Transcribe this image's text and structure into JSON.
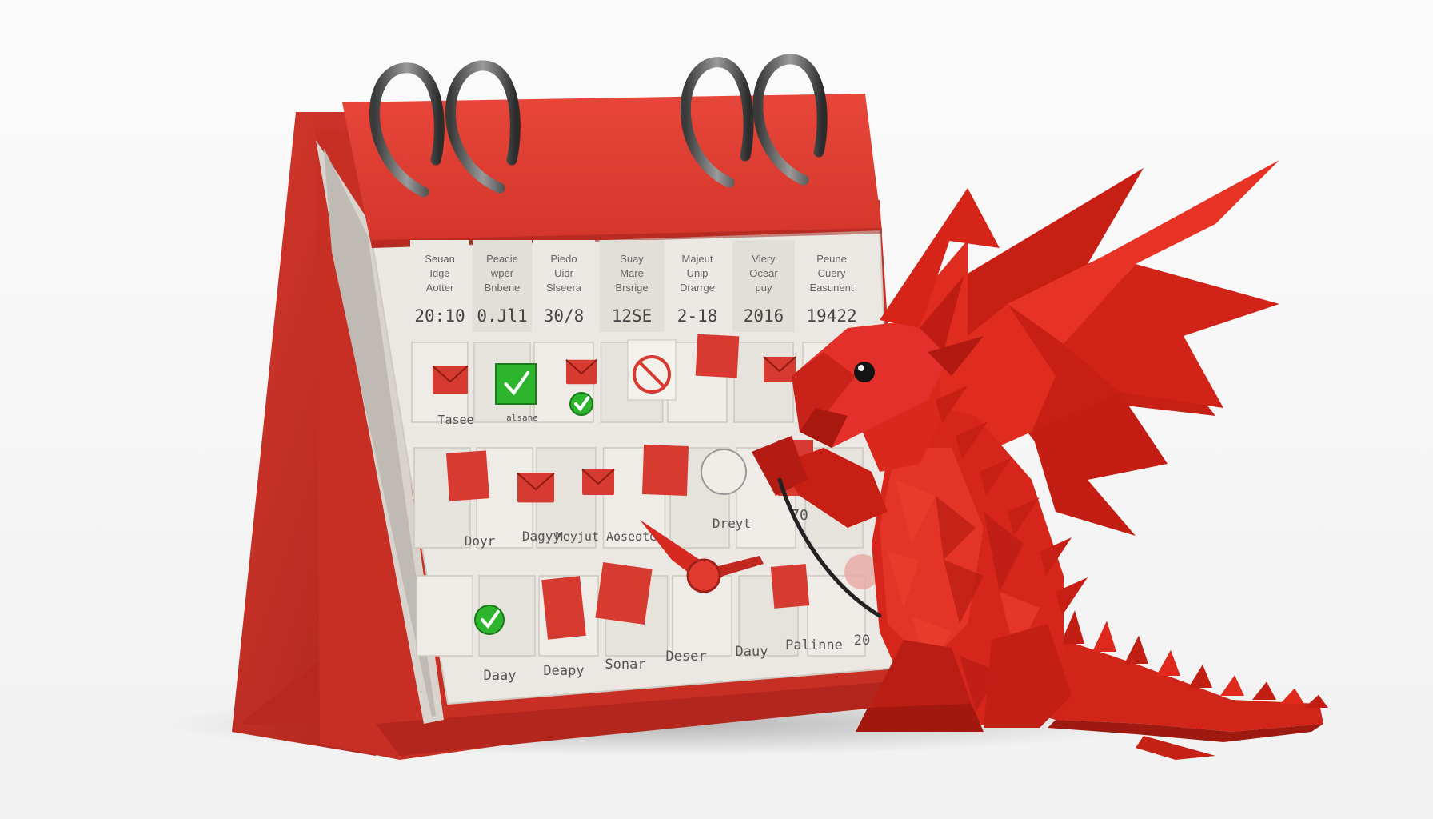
{
  "calendar": {
    "columns": [
      {
        "header": [
          "Seuan",
          "Idge",
          "Aotter"
        ],
        "number": "20:10"
      },
      {
        "header": [
          "Peacie",
          "wper",
          "Bnbene"
        ],
        "number": "0.Jl1"
      },
      {
        "header": [
          "Piedo",
          "Uidr",
          "Slseera"
        ],
        "number": "30/8"
      },
      {
        "header": [
          "Suay",
          "Mare",
          "Brsrige"
        ],
        "number": "12SE"
      },
      {
        "header": [
          "Majeut",
          "Unip",
          "Drarrge"
        ],
        "number": "2-18"
      },
      {
        "header": [
          "Viery",
          "Ocear",
          "puy"
        ],
        "number": "2016"
      },
      {
        "header": [
          "Peune",
          "Cuery",
          "Easunent"
        ],
        "number": "19422"
      }
    ],
    "row1_labels": [
      "Tasee",
      "alsane"
    ],
    "row2_labels": [
      "Doyr",
      "Dagyy",
      "Meyjut Aoseote",
      "Dreyt",
      "70"
    ],
    "row3_labels": [
      "Daay",
      "Deapy",
      "Sonar",
      "Deser",
      "Dauy",
      "Palinne",
      "20"
    ],
    "status_colors": {
      "done": "#2db52d",
      "missed": "#d63a30"
    }
  },
  "colors": {
    "calendar_red": "#e0392e",
    "calendar_red_dark": "#b82a22",
    "page": "#ebe8e3",
    "dragon": "#d9271c",
    "dragon_dark": "#a91a12",
    "background": "#f7f7f7"
  },
  "scene": {
    "objects": [
      "desk-calendar",
      "origami-dragon"
    ]
  }
}
